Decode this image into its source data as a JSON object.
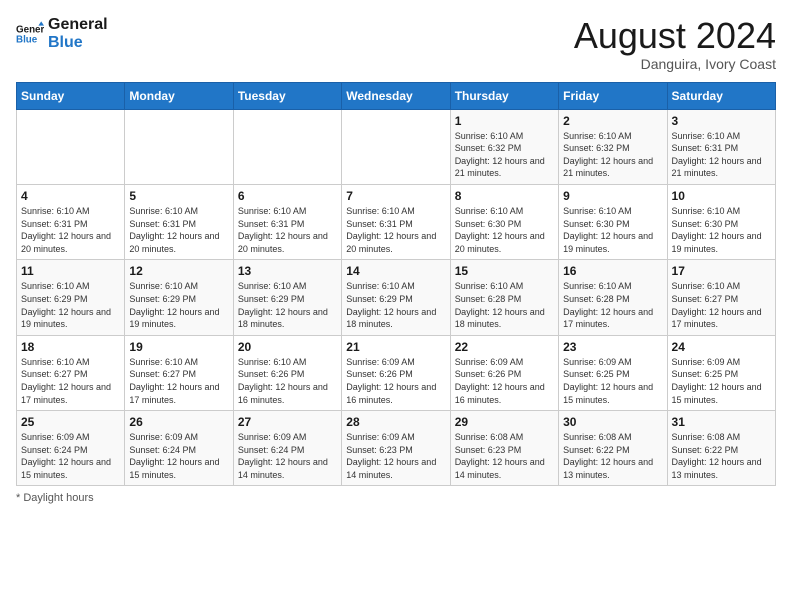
{
  "header": {
    "logo_line1": "General",
    "logo_line2": "Blue",
    "month_year": "August 2024",
    "location": "Danguira, Ivory Coast"
  },
  "weekdays": [
    "Sunday",
    "Monday",
    "Tuesday",
    "Wednesday",
    "Thursday",
    "Friday",
    "Saturday"
  ],
  "weeks": [
    [
      {
        "day": "",
        "info": ""
      },
      {
        "day": "",
        "info": ""
      },
      {
        "day": "",
        "info": ""
      },
      {
        "day": "",
        "info": ""
      },
      {
        "day": "1",
        "info": "Sunrise: 6:10 AM\nSunset: 6:32 PM\nDaylight: 12 hours and 21 minutes."
      },
      {
        "day": "2",
        "info": "Sunrise: 6:10 AM\nSunset: 6:32 PM\nDaylight: 12 hours and 21 minutes."
      },
      {
        "day": "3",
        "info": "Sunrise: 6:10 AM\nSunset: 6:31 PM\nDaylight: 12 hours and 21 minutes."
      }
    ],
    [
      {
        "day": "4",
        "info": "Sunrise: 6:10 AM\nSunset: 6:31 PM\nDaylight: 12 hours and 20 minutes."
      },
      {
        "day": "5",
        "info": "Sunrise: 6:10 AM\nSunset: 6:31 PM\nDaylight: 12 hours and 20 minutes."
      },
      {
        "day": "6",
        "info": "Sunrise: 6:10 AM\nSunset: 6:31 PM\nDaylight: 12 hours and 20 minutes."
      },
      {
        "day": "7",
        "info": "Sunrise: 6:10 AM\nSunset: 6:31 PM\nDaylight: 12 hours and 20 minutes."
      },
      {
        "day": "8",
        "info": "Sunrise: 6:10 AM\nSunset: 6:30 PM\nDaylight: 12 hours and 20 minutes."
      },
      {
        "day": "9",
        "info": "Sunrise: 6:10 AM\nSunset: 6:30 PM\nDaylight: 12 hours and 19 minutes."
      },
      {
        "day": "10",
        "info": "Sunrise: 6:10 AM\nSunset: 6:30 PM\nDaylight: 12 hours and 19 minutes."
      }
    ],
    [
      {
        "day": "11",
        "info": "Sunrise: 6:10 AM\nSunset: 6:29 PM\nDaylight: 12 hours and 19 minutes."
      },
      {
        "day": "12",
        "info": "Sunrise: 6:10 AM\nSunset: 6:29 PM\nDaylight: 12 hours and 19 minutes."
      },
      {
        "day": "13",
        "info": "Sunrise: 6:10 AM\nSunset: 6:29 PM\nDaylight: 12 hours and 18 minutes."
      },
      {
        "day": "14",
        "info": "Sunrise: 6:10 AM\nSunset: 6:29 PM\nDaylight: 12 hours and 18 minutes."
      },
      {
        "day": "15",
        "info": "Sunrise: 6:10 AM\nSunset: 6:28 PM\nDaylight: 12 hours and 18 minutes."
      },
      {
        "day": "16",
        "info": "Sunrise: 6:10 AM\nSunset: 6:28 PM\nDaylight: 12 hours and 17 minutes."
      },
      {
        "day": "17",
        "info": "Sunrise: 6:10 AM\nSunset: 6:27 PM\nDaylight: 12 hours and 17 minutes."
      }
    ],
    [
      {
        "day": "18",
        "info": "Sunrise: 6:10 AM\nSunset: 6:27 PM\nDaylight: 12 hours and 17 minutes."
      },
      {
        "day": "19",
        "info": "Sunrise: 6:10 AM\nSunset: 6:27 PM\nDaylight: 12 hours and 17 minutes."
      },
      {
        "day": "20",
        "info": "Sunrise: 6:10 AM\nSunset: 6:26 PM\nDaylight: 12 hours and 16 minutes."
      },
      {
        "day": "21",
        "info": "Sunrise: 6:09 AM\nSunset: 6:26 PM\nDaylight: 12 hours and 16 minutes."
      },
      {
        "day": "22",
        "info": "Sunrise: 6:09 AM\nSunset: 6:26 PM\nDaylight: 12 hours and 16 minutes."
      },
      {
        "day": "23",
        "info": "Sunrise: 6:09 AM\nSunset: 6:25 PM\nDaylight: 12 hours and 15 minutes."
      },
      {
        "day": "24",
        "info": "Sunrise: 6:09 AM\nSunset: 6:25 PM\nDaylight: 12 hours and 15 minutes."
      }
    ],
    [
      {
        "day": "25",
        "info": "Sunrise: 6:09 AM\nSunset: 6:24 PM\nDaylight: 12 hours and 15 minutes."
      },
      {
        "day": "26",
        "info": "Sunrise: 6:09 AM\nSunset: 6:24 PM\nDaylight: 12 hours and 15 minutes."
      },
      {
        "day": "27",
        "info": "Sunrise: 6:09 AM\nSunset: 6:24 PM\nDaylight: 12 hours and 14 minutes."
      },
      {
        "day": "28",
        "info": "Sunrise: 6:09 AM\nSunset: 6:23 PM\nDaylight: 12 hours and 14 minutes."
      },
      {
        "day": "29",
        "info": "Sunrise: 6:08 AM\nSunset: 6:23 PM\nDaylight: 12 hours and 14 minutes."
      },
      {
        "day": "30",
        "info": "Sunrise: 6:08 AM\nSunset: 6:22 PM\nDaylight: 12 hours and 13 minutes."
      },
      {
        "day": "31",
        "info": "Sunrise: 6:08 AM\nSunset: 6:22 PM\nDaylight: 12 hours and 13 minutes."
      }
    ]
  ],
  "footer": {
    "daylight_label": "Daylight hours"
  }
}
